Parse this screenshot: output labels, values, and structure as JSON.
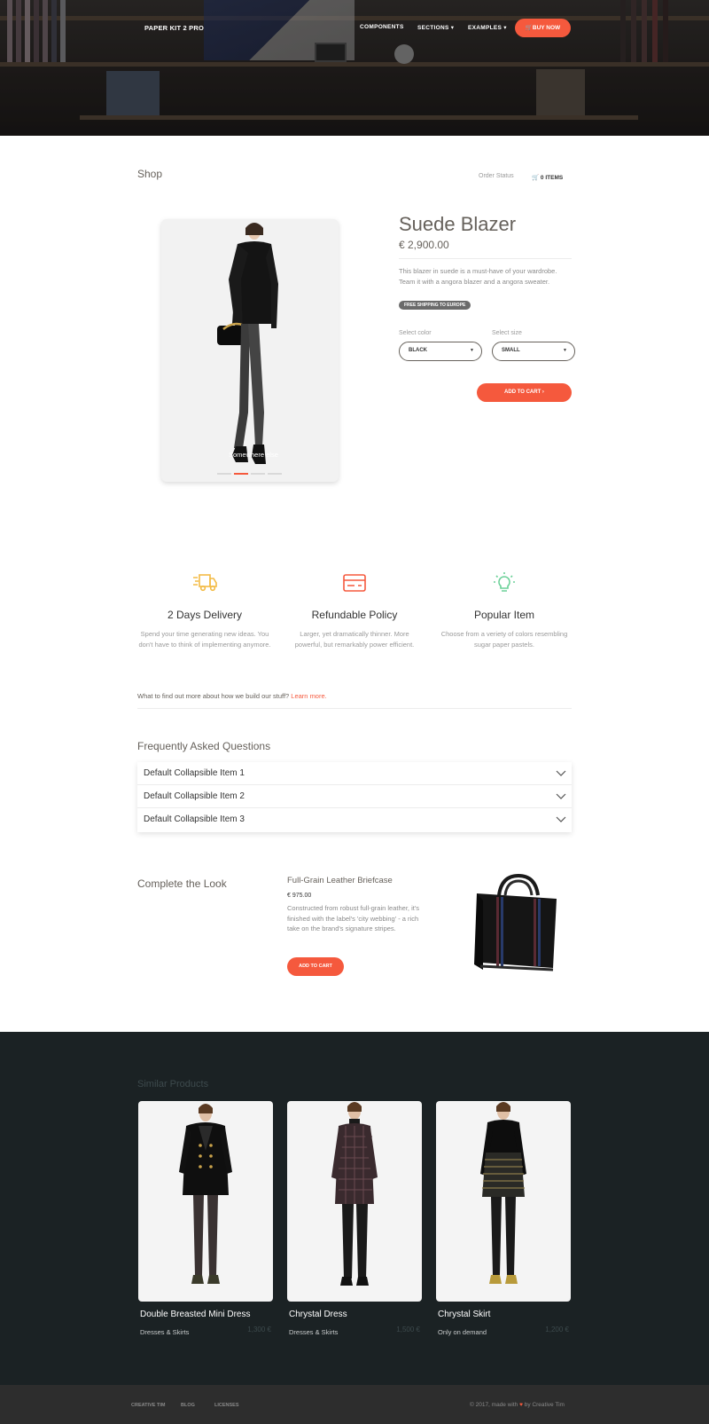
{
  "header": {
    "brand": "PAPER KIT 2 PRO",
    "nav": [
      "COMPONENTS",
      "SECTIONS ▾",
      "EXAMPLES ▾"
    ],
    "buy_button": "BUY NOW"
  },
  "shop": {
    "title": "Shop",
    "order_status": "Order Status",
    "cart_items": "0 ITEMS"
  },
  "product": {
    "name": "Suede Blazer",
    "price": "€ 2,900.00",
    "description": "This blazer in suede is a must-have of your wardrobe. Team it with a angora blazer and a angora sweater.",
    "badge": "FREE SHIPPING TO EUROPE",
    "caption": "Somewhere else",
    "carousel_active": 1,
    "color_label": "Select color",
    "color_value": "BLACK",
    "size_label": "Select size",
    "size_value": "SMALL",
    "add_to_cart": "ADD TO CART  ›"
  },
  "features": [
    {
      "icon": "delivery-truck-icon",
      "title": "2 Days Delivery",
      "text": "Spend your time generating new ideas. You don't have to think of implementing anymore.",
      "color": "#f3bb45"
    },
    {
      "icon": "credit-card-icon",
      "title": "Refundable Policy",
      "text": "Larger, yet dramatically thinner. More powerful, but remarkably power efficient.",
      "color": "#f5593d"
    },
    {
      "icon": "lightbulb-icon",
      "title": "Popular Item",
      "text": "Choose from a veriety of colors resembling sugar paper pastels.",
      "color": "#6bd098"
    }
  ],
  "learn_more": {
    "text": "What to find out more about how we build our stuff? ",
    "link": "Learn more."
  },
  "faq": {
    "title": "Frequently Asked Questions",
    "items": [
      "Default Collapsible Item 1",
      "Default Collapsible Item 2",
      "Default Collapsible Item 3"
    ]
  },
  "complete_look": {
    "title": "Complete the Look",
    "product_name": "Full-Grain Leather Briefcase",
    "price": "€ 975.00",
    "description": "Constructed from robust full-grain leather, it's finished with the label's 'city webbing' - a rich take on the brand's signature stripes.",
    "button": "ADD TO CART"
  },
  "similar": {
    "title": "Similar Products",
    "items": [
      {
        "name": "Double Breasted Mini Dress",
        "category": "Dresses & Skirts",
        "price": "1,300 €"
      },
      {
        "name": "Chrystal Dress",
        "category": "Dresses & Skirts",
        "price": "1,500 €"
      },
      {
        "name": "Chrystal Skirt",
        "category": "Only on demand",
        "price": "1,200 €"
      }
    ]
  },
  "footer": {
    "links": [
      "CREATIVE TIM",
      "BLOG",
      "LICENSES"
    ],
    "copyright_prefix": "© 2017, made with ",
    "copyright_suffix": " by Creative Tim"
  },
  "colors": {
    "accent": "#f5593d",
    "dark_section": "#1b2224",
    "footer": "#2d2d2d"
  }
}
